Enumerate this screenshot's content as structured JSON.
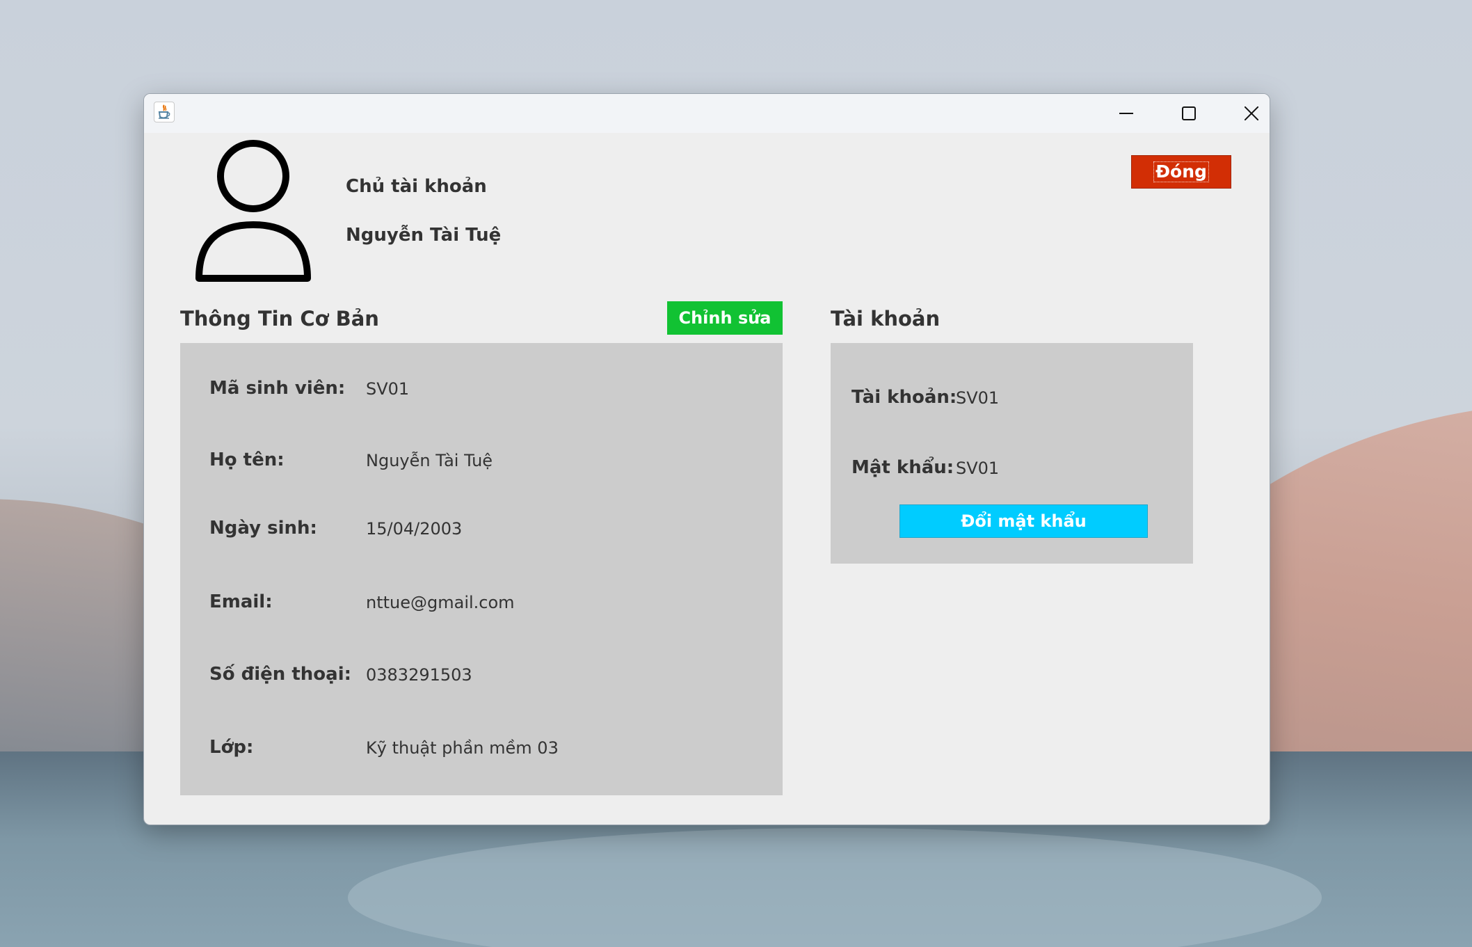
{
  "window": {
    "minimize_icon": "minimize-icon",
    "maximize_icon": "maximize-icon",
    "close_icon": "close-icon",
    "app_icon": "java-coffee-cup-icon"
  },
  "header": {
    "avatar_icon": "user-avatar-icon",
    "owner_caption": "Chủ tài khoản",
    "owner_name": "Nguyễn Tài Tuệ",
    "close_button": "Đóng"
  },
  "basic_info": {
    "title": "Thông Tin Cơ Bản",
    "edit_button": "Chỉnh sửa",
    "fields": [
      {
        "label": "Mã sinh viên:",
        "value": "SV01"
      },
      {
        "label": "Họ tên:",
        "value": "Nguyễn Tài Tuệ"
      },
      {
        "label": "Ngày sinh:",
        "value": "15/04/2003"
      },
      {
        "label": "Email:",
        "value": "nttue@gmail.com"
      },
      {
        "label": "Số điện thoại:",
        "value": "0383291503"
      },
      {
        "label": "Lớp:",
        "value": "Kỹ thuật phần mềm 03"
      }
    ]
  },
  "account": {
    "title": "Tài khoản",
    "username_label": "Tài khoản:",
    "username_value": "SV01",
    "password_label": "Mật khẩu:",
    "password_value": "SV01",
    "change_password_button": "Đổi mật khẩu"
  },
  "colors": {
    "close_button": "#d22e05",
    "edit_button": "#11c233",
    "change_password_button": "#00ccff",
    "panel_background": "#cccccc",
    "window_background": "#eeeeee"
  }
}
